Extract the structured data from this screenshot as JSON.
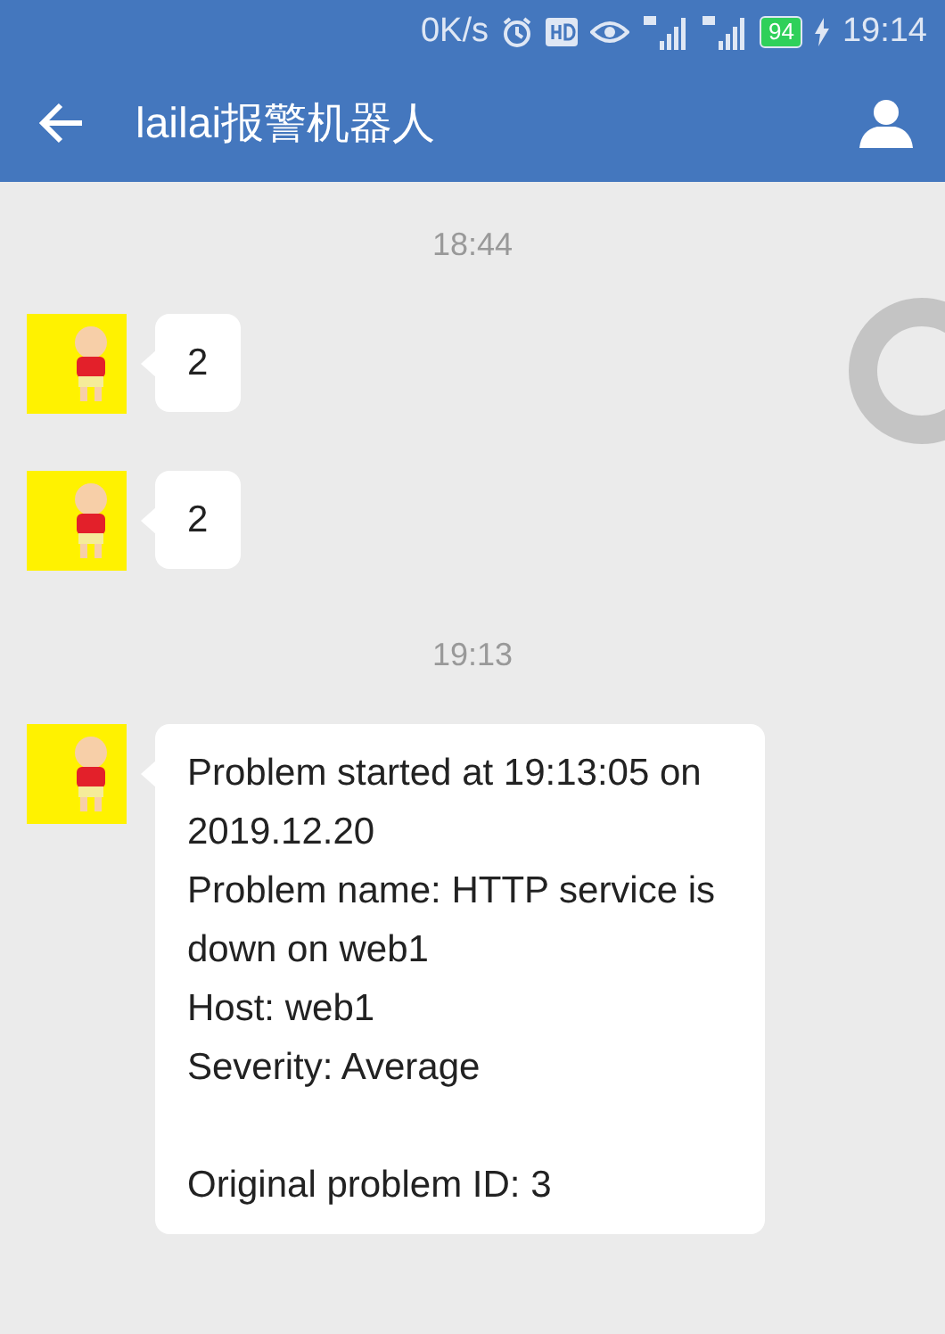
{
  "status_bar": {
    "net_speed": "0K/s",
    "battery": "94",
    "time": "19:14"
  },
  "app_bar": {
    "title": "lailai报警机器人"
  },
  "chat": [
    {
      "kind": "time",
      "text": "18:44"
    },
    {
      "kind": "message",
      "paragraphs": [
        [
          "2"
        ]
      ]
    },
    {
      "kind": "message",
      "paragraphs": [
        [
          "2"
        ]
      ]
    },
    {
      "kind": "time",
      "text": "19:13"
    },
    {
      "kind": "message",
      "paragraphs": [
        [
          "Problem started at 19:13:05 on 2019.12.20",
          "Problem name: HTTP service is down on web1",
          "Host: web1",
          "Severity: Average"
        ],
        [
          "Original problem ID: 3"
        ]
      ]
    }
  ]
}
